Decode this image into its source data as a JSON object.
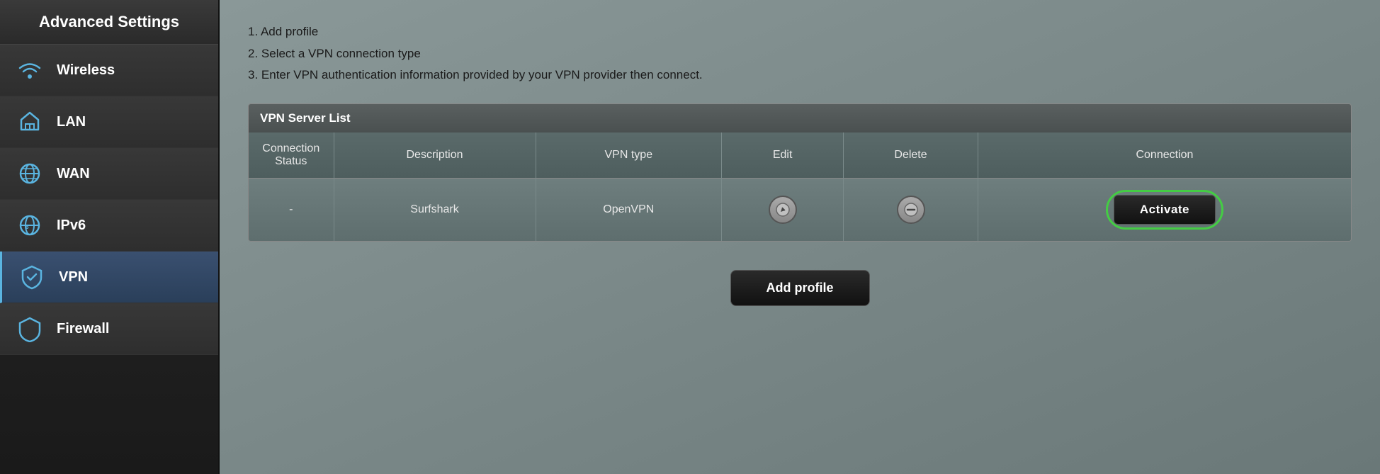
{
  "sidebar": {
    "title": "Advanced Settings",
    "items": [
      {
        "id": "wireless",
        "label": "Wireless",
        "icon": "wireless-icon",
        "active": false
      },
      {
        "id": "lan",
        "label": "LAN",
        "icon": "lan-icon",
        "active": false
      },
      {
        "id": "wan",
        "label": "WAN",
        "icon": "wan-icon",
        "active": false
      },
      {
        "id": "ipv6",
        "label": "IPv6",
        "icon": "ipv6-icon",
        "active": false
      },
      {
        "id": "vpn",
        "label": "VPN",
        "icon": "vpn-icon",
        "active": true
      },
      {
        "id": "firewall",
        "label": "Firewall",
        "icon": "firewall-icon",
        "active": false
      }
    ]
  },
  "main": {
    "instructions": [
      "1. Add profile",
      "2. Select a VPN connection type",
      "3. Enter VPN authentication information provided by your VPN provider then connect."
    ],
    "vpn_server_list": {
      "section_title": "VPN Server List",
      "columns": {
        "connection_status": "Connection\nStatus",
        "description": "Description",
        "vpn_type": "VPN type",
        "edit": "Edit",
        "delete": "Delete",
        "connection": "Connection"
      },
      "rows": [
        {
          "connection_status": "-",
          "description": "Surfshark",
          "vpn_type": "OpenVPN",
          "edit_label": "✎",
          "delete_label": "⊖",
          "connection_label": "Activate"
        }
      ]
    },
    "add_profile_button": "Add profile"
  },
  "colors": {
    "accent_cyan": "#5ab4e0",
    "activate_highlight": "#44cc44"
  }
}
